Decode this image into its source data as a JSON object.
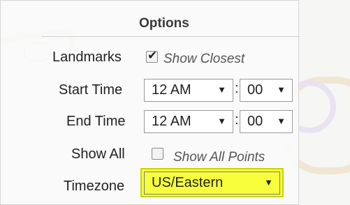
{
  "panel": {
    "title": "Options"
  },
  "landmarks": {
    "label": "Landmarks",
    "checked": true,
    "option_text": "Show Closest"
  },
  "start_time": {
    "label": "Start Time",
    "hour": "12 AM",
    "minute": "00",
    "separator": ":"
  },
  "end_time": {
    "label": "End Time",
    "hour": "12 AM",
    "minute": "00",
    "separator": ":"
  },
  "show_all": {
    "label": "Show All",
    "checked": false,
    "option_text": "Show All Points"
  },
  "timezone": {
    "label": "Timezone",
    "value": "US/Eastern",
    "highlight_color": "#f7ff3c"
  },
  "icons": {
    "dropdown": "▼"
  }
}
